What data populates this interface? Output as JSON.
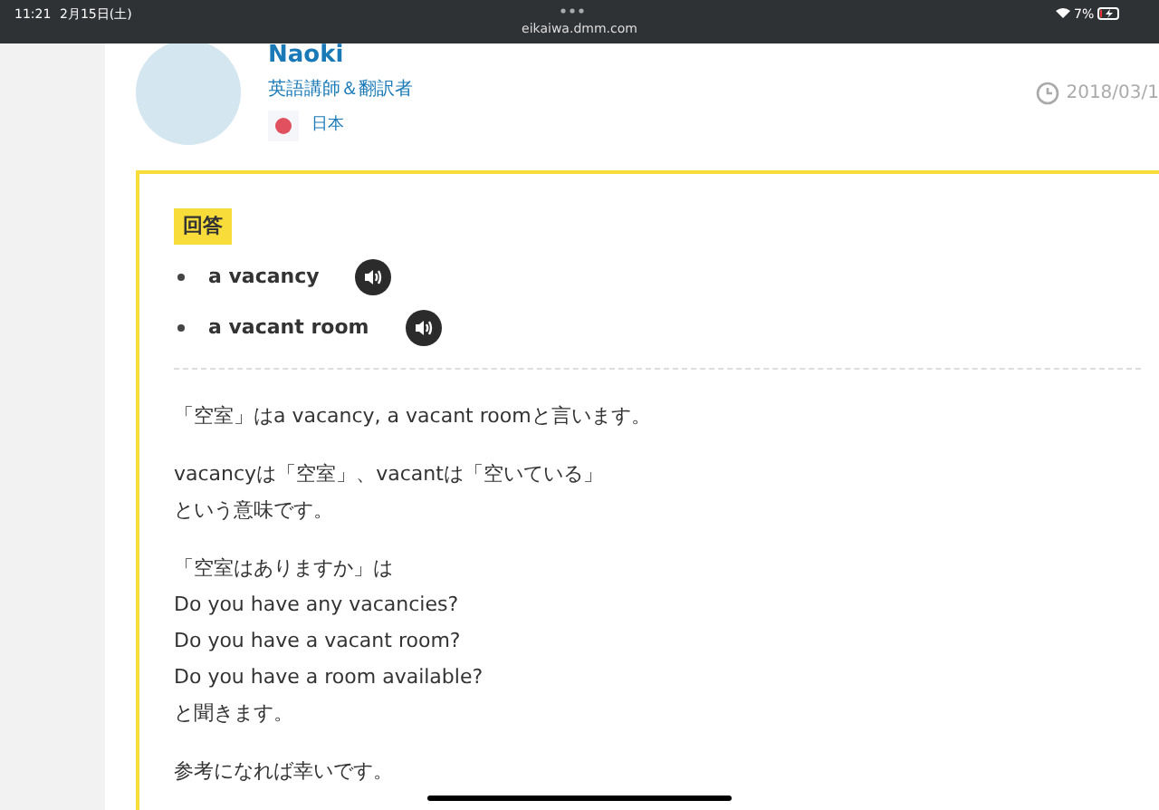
{
  "status_bar": {
    "time": "11:21",
    "date": "2月15日(土)",
    "url": "eikaiwa.dmm.com",
    "battery": "7%"
  },
  "author": {
    "name": "Naoki",
    "role": "英語講師＆翻訳者",
    "country": "日本",
    "date": "2018/03/1"
  },
  "answer": {
    "badge": "回答",
    "phrases": [
      {
        "text": "a vacancy"
      },
      {
        "text": "a vacant room"
      }
    ],
    "paragraphs": [
      {
        "lines": [
          "「空室」はa vacancy, a vacant roomと言います。"
        ]
      },
      {
        "lines": [
          "vacancyは「空室」、vacantは「空いている」",
          "という意味です。"
        ]
      },
      {
        "lines": [
          "「空室はありますか」は",
          "Do you have any vacancies?",
          "Do you have a vacant room?",
          "Do you have a room available?",
          "と聞きます。"
        ]
      },
      {
        "lines": [
          "参考になれば幸いです。"
        ]
      }
    ]
  }
}
